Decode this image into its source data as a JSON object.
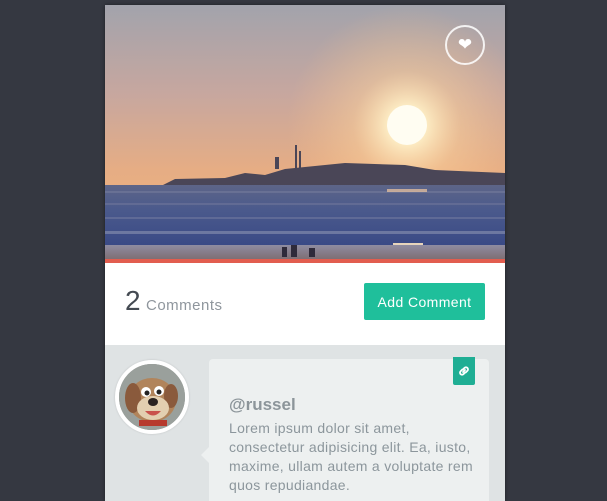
{
  "post": {
    "like_icon": "heart-icon"
  },
  "comments_bar": {
    "count": "2",
    "count_label": "Comments",
    "add_button": "Add Comment"
  },
  "comment": {
    "username": "@russel",
    "text": "Lorem ipsum dolor sit amet, consectetur adipisicing elit. Ea, iusto, maxime, ullam autem a voluptate rem quos repudiandae.",
    "link_icon": "link-icon"
  },
  "colors": {
    "background": "#353841",
    "accent": "#1fbf9b",
    "strip": "#e25d4f"
  }
}
